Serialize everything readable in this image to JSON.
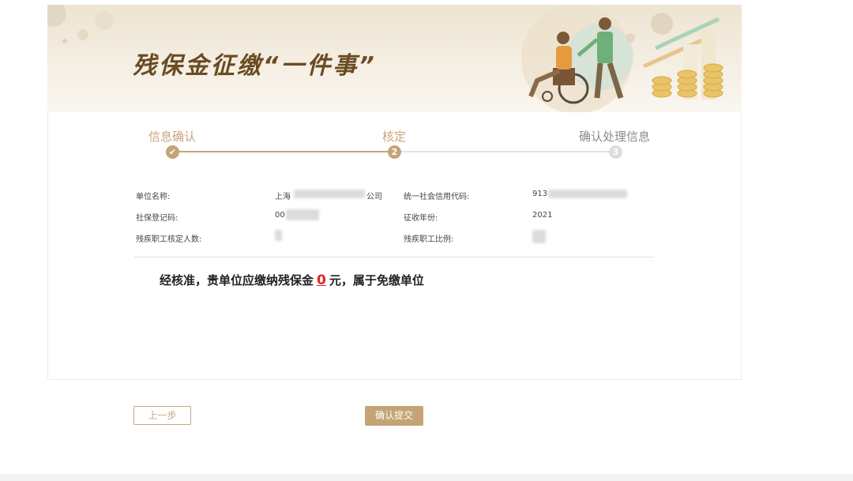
{
  "banner": {
    "title": "残保金征缴“一件事”"
  },
  "steps": [
    {
      "label": "信息确认",
      "marker": "✔",
      "state": "done"
    },
    {
      "label": "核定",
      "marker": "2",
      "state": "current"
    },
    {
      "label": "确认处理信息",
      "marker": "3",
      "state": "pending"
    }
  ],
  "info": {
    "unit_name_label": "单位名称:",
    "unit_name_prefix": "上海",
    "unit_name_suffix": "公司",
    "credit_code_label": "统一社会信用代码:",
    "credit_code_prefix": "913",
    "social_reg_label": "社保登记码:",
    "social_reg_prefix": "00",
    "year_label": "征收年份:",
    "year_value": "2021",
    "disabled_count_label": "残疾职工核定人数:",
    "disabled_ratio_label": "残疾职工比例:"
  },
  "result": {
    "prefix": "经核准，贵单位应缴纳残保金",
    "amount": "0",
    "suffix": "元，属于免缴单位"
  },
  "buttons": {
    "prev": "上一步",
    "submit": "确认提交"
  },
  "colors": {
    "accent": "#c4a375",
    "amount": "#e02424"
  }
}
